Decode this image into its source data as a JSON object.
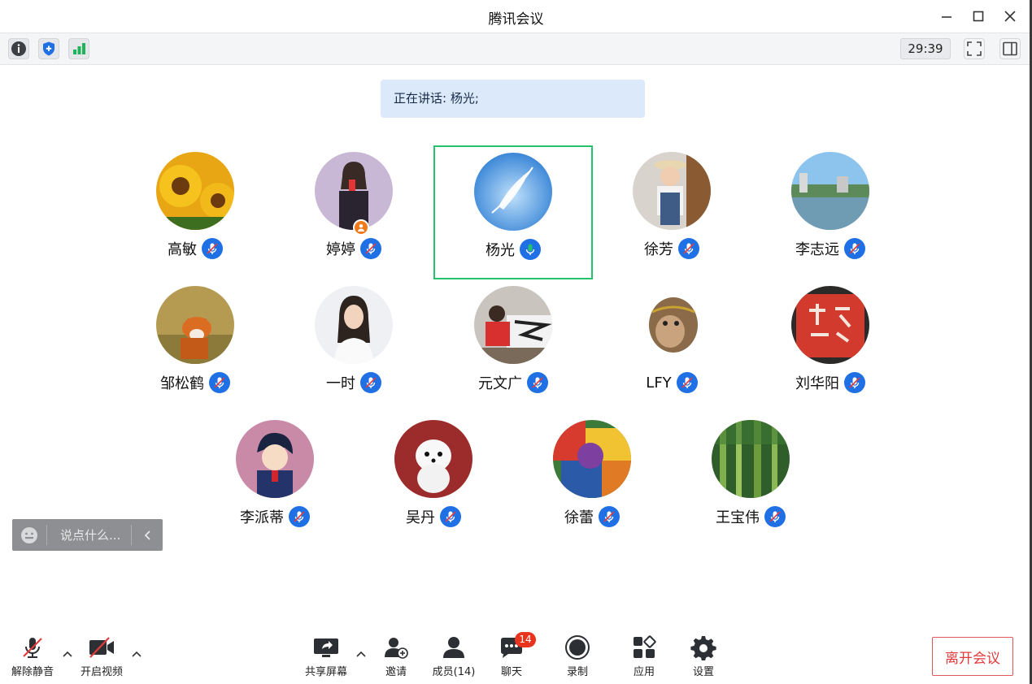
{
  "window": {
    "title": "腾讯会议"
  },
  "toolbar": {
    "info_icon": "info-icon",
    "security_icon": "shield-icon",
    "network_icon": "signal-icon",
    "timer": "29:39"
  },
  "speaking": {
    "text": "正在讲话: 杨光;"
  },
  "participants": [
    {
      "name": "高敏"
    },
    {
      "name": "婷婷"
    },
    {
      "name": "杨光"
    },
    {
      "name": "徐芳"
    },
    {
      "name": "李志远"
    },
    {
      "name": "邹松鹤"
    },
    {
      "name": "一时"
    },
    {
      "name": "元文广"
    },
    {
      "name": "LFY"
    },
    {
      "name": "刘华阳"
    },
    {
      "name": "李派蒂"
    },
    {
      "name": "吴丹"
    },
    {
      "name": "徐蕾"
    },
    {
      "name": "王宝伟"
    }
  ],
  "chat_input": {
    "placeholder": "说点什么..."
  },
  "bottombar": {
    "unmute": "解除静音",
    "video": "开启视频",
    "share": "共享屏幕",
    "invite": "邀请",
    "members": "成员(14)",
    "chat": "聊天",
    "chat_count": "14",
    "record": "录制",
    "apps": "应用",
    "settings": "设置",
    "leave": "离开会议"
  },
  "colors": {
    "accent": "#1f6fe5",
    "speaking_green": "#22c36a",
    "leave_red": "#e23b3b"
  }
}
